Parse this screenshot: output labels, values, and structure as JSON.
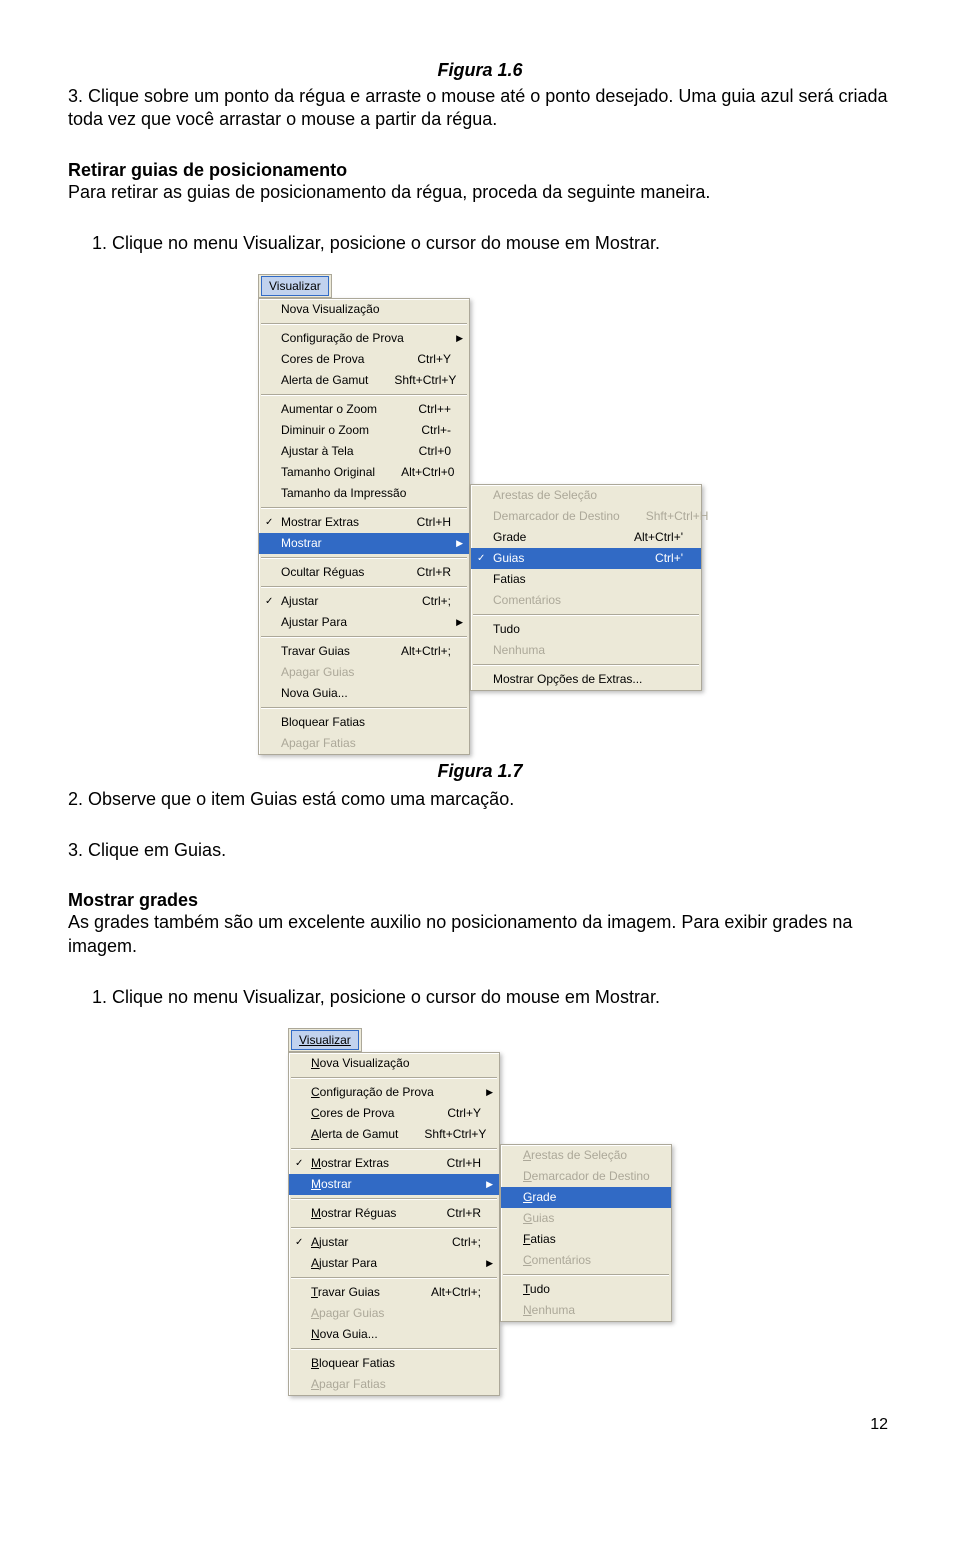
{
  "captions": {
    "fig16": "Figura 1.6",
    "fig17": "Figura 1.7"
  },
  "paragraphs": {
    "p1": "3. Clique sobre um ponto da régua e arraste o mouse até o ponto desejado. Uma guia azul será criada toda vez que você arrastar o mouse a partir da régua.",
    "h1": "Retirar guias de posicionamento",
    "p2": "Para retirar as guias de posicionamento da régua, proceda da seguinte maneira.",
    "n1": "1.  Clique no menu Visualizar, posicione o cursor do mouse em Mostrar.",
    "p3": "2. Observe que o item Guias está como uma marcação.",
    "p4": "3. Clique em Guias.",
    "h2": "Mostrar grades",
    "p5": "As grades também são um excelente auxilio no posicionamento da imagem. Para exibir grades na imagem.",
    "n2": "1.  Clique no menu Visualizar, posicione o cursor do mouse em Mostrar."
  },
  "menu1": {
    "menubar": "Visualizar",
    "items": [
      {
        "label": "Nova Visualização"
      },
      {
        "sep": true
      },
      {
        "label": "Configuração de Prova",
        "arrow": true
      },
      {
        "label": "Cores de Prova",
        "shortcut": "Ctrl+Y"
      },
      {
        "label": "Alerta de Gamut",
        "shortcut": "Shft+Ctrl+Y"
      },
      {
        "sep": true
      },
      {
        "label": "Aumentar o Zoom",
        "shortcut": "Ctrl++"
      },
      {
        "label": "Diminuir o Zoom",
        "shortcut": "Ctrl+-"
      },
      {
        "label": "Ajustar à Tela",
        "shortcut": "Ctrl+0"
      },
      {
        "label": "Tamanho Original",
        "shortcut": "Alt+Ctrl+0"
      },
      {
        "label": "Tamanho da Impressão"
      },
      {
        "sep": true
      },
      {
        "label": "Mostrar Extras",
        "shortcut": "Ctrl+H",
        "check": true
      },
      {
        "label": "Mostrar",
        "arrow": true,
        "sel": true
      },
      {
        "sep": true
      },
      {
        "label": "Ocultar Réguas",
        "shortcut": "Ctrl+R"
      },
      {
        "sep": true
      },
      {
        "label": "Ajustar",
        "shortcut": "Ctrl+;",
        "check": true
      },
      {
        "label": "Ajustar Para",
        "arrow": true
      },
      {
        "sep": true
      },
      {
        "label": "Travar Guias",
        "shortcut": "Alt+Ctrl+;"
      },
      {
        "label": "Apagar Guias",
        "disabled": true
      },
      {
        "label": "Nova Guia..."
      },
      {
        "sep": true
      },
      {
        "label": "Bloquear Fatias"
      },
      {
        "label": "Apagar Fatias",
        "disabled": true
      }
    ],
    "submenu": [
      {
        "label": "Arestas de Seleção",
        "disabled": true
      },
      {
        "label": "Demarcador de Destino",
        "shortcut": "Shft+Ctrl+H",
        "disabled": true
      },
      {
        "label": "Grade",
        "shortcut": "Alt+Ctrl+'"
      },
      {
        "label": "Guias",
        "shortcut": "Ctrl+'",
        "sel": true,
        "check": true
      },
      {
        "label": "Fatias"
      },
      {
        "label": "Comentários",
        "disabled": true
      },
      {
        "sep": true
      },
      {
        "label": "Tudo"
      },
      {
        "label": "Nenhuma",
        "disabled": true
      },
      {
        "sep": true
      },
      {
        "label": "Mostrar Opções de Extras..."
      }
    ]
  },
  "menu2": {
    "menubar": "Visualizar",
    "items": [
      {
        "label": "Nova Visualização"
      },
      {
        "sep": true
      },
      {
        "label": "Configuração de Prova",
        "arrow": true
      },
      {
        "label": "Cores de Prova",
        "shortcut": "Ctrl+Y"
      },
      {
        "label": "Alerta de Gamut",
        "shortcut": "Shft+Ctrl+Y"
      },
      {
        "sep": true
      },
      {
        "label": "Mostrar Extras",
        "shortcut": "Ctrl+H",
        "check": true
      },
      {
        "label": "Mostrar",
        "arrow": true,
        "sel": true
      },
      {
        "sep": true
      },
      {
        "label": "Mostrar Réguas",
        "shortcut": "Ctrl+R"
      },
      {
        "sep": true
      },
      {
        "label": "Ajustar",
        "shortcut": "Ctrl+;",
        "check": true
      },
      {
        "label": "Ajustar Para",
        "arrow": true
      },
      {
        "sep": true
      },
      {
        "label": "Travar Guias",
        "shortcut": "Alt+Ctrl+;"
      },
      {
        "label": "Apagar Guias",
        "disabled": true
      },
      {
        "label": "Nova Guia..."
      },
      {
        "sep": true
      },
      {
        "label": "Bloquear Fatias"
      },
      {
        "label": "Apagar Fatias",
        "disabled": true
      }
    ],
    "submenu": [
      {
        "label": "Arestas de Seleção",
        "disabled": true
      },
      {
        "label": "Demarcador de Destino",
        "disabled": true
      },
      {
        "label": "Grade",
        "sel": true
      },
      {
        "label": "Guias",
        "disabled": true
      },
      {
        "label": "Fatias"
      },
      {
        "label": "Comentários",
        "disabled": true
      },
      {
        "sep": true
      },
      {
        "label": "Tudo"
      },
      {
        "label": "Nenhuma",
        "disabled": true
      }
    ]
  },
  "pagenum": "12"
}
